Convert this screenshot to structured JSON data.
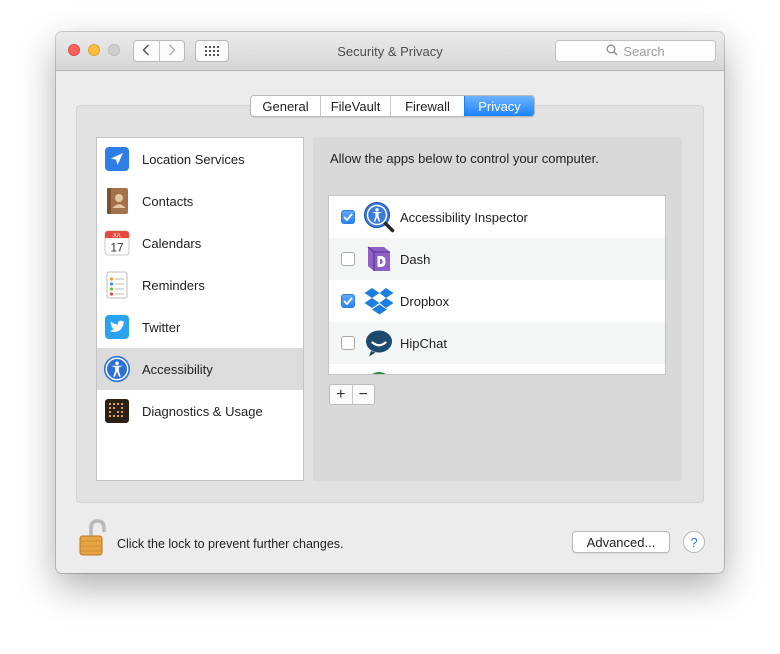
{
  "window": {
    "title": "Security & Privacy",
    "search_placeholder": "Search",
    "back_label": "‹",
    "forward_label": "›"
  },
  "tabs": [
    {
      "label": "General",
      "active": false
    },
    {
      "label": "FileVault",
      "active": false
    },
    {
      "label": "Firewall",
      "active": false
    },
    {
      "label": "Privacy",
      "active": true
    }
  ],
  "sidebar": {
    "items": [
      {
        "label": "Location Services",
        "icon": "location-arrow-icon"
      },
      {
        "label": "Contacts",
        "icon": "contacts-book-icon"
      },
      {
        "label": "Calendars",
        "icon": "calendar-icon",
        "icon_month": "JUL",
        "icon_day": "17"
      },
      {
        "label": "Reminders",
        "icon": "reminders-list-icon"
      },
      {
        "label": "Twitter",
        "icon": "twitter-bird-icon"
      },
      {
        "label": "Accessibility",
        "icon": "accessibility-person-icon",
        "selected": true
      },
      {
        "label": "Diagnostics & Usage",
        "icon": "diagnostics-grid-icon"
      }
    ]
  },
  "main": {
    "instruction": "Allow the apps below to control your computer.",
    "apps": [
      {
        "name": "Accessibility Inspector",
        "checked": true,
        "icon": "accessibility-inspector-icon"
      },
      {
        "name": "Dash",
        "checked": false,
        "icon": "dash-icon"
      },
      {
        "name": "Dropbox",
        "checked": true,
        "icon": "dropbox-icon"
      },
      {
        "name": "HipChat",
        "checked": false,
        "icon": "hipchat-icon"
      }
    ],
    "add_label": "+",
    "remove_label": "−"
  },
  "footer": {
    "lock_text": "Click the lock to prevent further changes.",
    "advanced_label": "Advanced...",
    "help_label": "?"
  },
  "colors": {
    "accent": "#1a82fb",
    "sidebar_selected": "#dcdcdc",
    "window_bg": "#ececec",
    "lock": "#e8a443"
  }
}
